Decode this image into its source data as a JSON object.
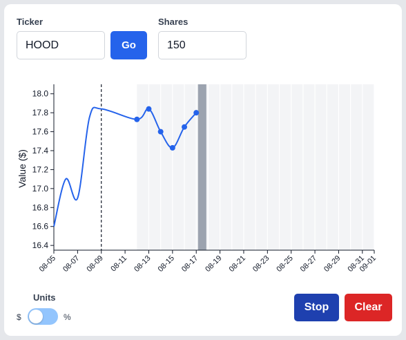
{
  "form": {
    "ticker_label": "Ticker",
    "ticker_value": "HOOD",
    "go_label": "Go",
    "shares_label": "Shares",
    "shares_value": "150"
  },
  "controls": {
    "units_label": "Units",
    "unit_dollar": "$",
    "unit_percent": "%",
    "units_is_percent": false,
    "stop_label": "Stop",
    "clear_label": "Clear"
  },
  "colors": {
    "go": "#2563eb",
    "stop": "#1e40af",
    "clear": "#dc2626",
    "line": "#2563eb",
    "toggle_track": "#93c5fd",
    "shade": "#f3f4f6",
    "current_band": "#9ca3af"
  },
  "chart_data": {
    "type": "line",
    "title": "",
    "xlabel": "",
    "ylabel": "Value ($)",
    "ylim": [
      16.35,
      18.1
    ],
    "xlim": [
      "2024-08-05",
      "2024-09-01"
    ],
    "x_tick_labels": [
      "08-05",
      "08-07",
      "08-09",
      "08-11",
      "08-13",
      "08-15",
      "08-17",
      "08-19",
      "08-21",
      "08-23",
      "08-25",
      "08-27",
      "08-29",
      "08-31",
      "09-01"
    ],
    "x_ticks": [
      "2024-08-05",
      "2024-08-07",
      "2024-08-09",
      "2024-08-11",
      "2024-08-13",
      "2024-08-15",
      "2024-08-17",
      "2024-08-19",
      "2024-08-21",
      "2024-08-23",
      "2024-08-25",
      "2024-08-27",
      "2024-08-29",
      "2024-08-31",
      "2024-09-01"
    ],
    "y_ticks": [
      16.4,
      16.6,
      16.8,
      17.0,
      17.2,
      17.4,
      17.6,
      17.8,
      18.0
    ],
    "y_tick_labels": [
      "16.4",
      "16.6",
      "16.8",
      "17.0",
      "17.2",
      "17.4",
      "17.6",
      "17.8",
      "18.0"
    ],
    "grid": false,
    "series": [
      {
        "x": [
          "2024-08-05",
          "2024-08-06",
          "2024-08-07",
          "2024-08-08",
          "2024-08-09",
          "2024-08-12",
          "2024-08-13",
          "2024-08-14",
          "2024-08-15",
          "2024-08-16",
          "2024-08-17"
        ],
        "y": [
          16.6,
          17.1,
          16.9,
          17.75,
          17.84,
          17.73,
          17.84,
          17.6,
          17.43,
          17.65,
          17.8
        ],
        "marked": [
          false,
          false,
          false,
          false,
          false,
          true,
          true,
          true,
          true,
          true,
          true
        ]
      }
    ],
    "divider_date": "2024-08-09",
    "shaded_from": "2024-08-12",
    "current_band_date": "2024-08-17.5"
  }
}
